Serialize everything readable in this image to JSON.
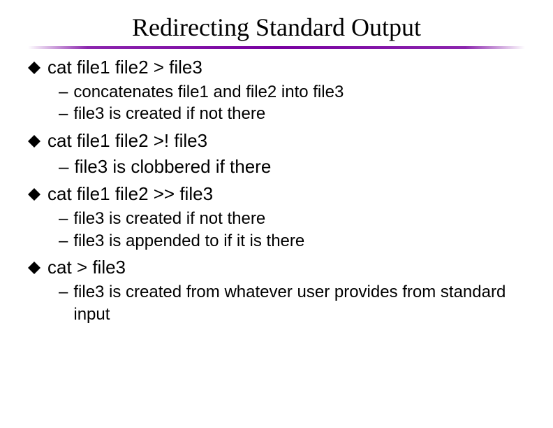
{
  "title": "Redirecting Standard Output",
  "bullets": [
    {
      "text": "cat file1 file2 > file3",
      "subs": [
        {
          "text": "concatenates file1 and file2 into file3",
          "large": false
        },
        {
          "text": "file3 is created if not there",
          "large": false
        }
      ]
    },
    {
      "text": "cat file1 file2 >! file3",
      "subs": [
        {
          "text": "file3 is clobbered if there",
          "large": true
        }
      ]
    },
    {
      "text": "cat file1 file2 >> file3",
      "subs": [
        {
          "text": "file3 is created if not there",
          "large": false
        },
        {
          "text": "file3 is appended to if it is there",
          "large": false
        }
      ]
    },
    {
      "text": "cat > file3",
      "subs": [
        {
          "text": "file3 is created from whatever user provides from standard input",
          "large": false
        }
      ]
    }
  ],
  "dash": "–"
}
